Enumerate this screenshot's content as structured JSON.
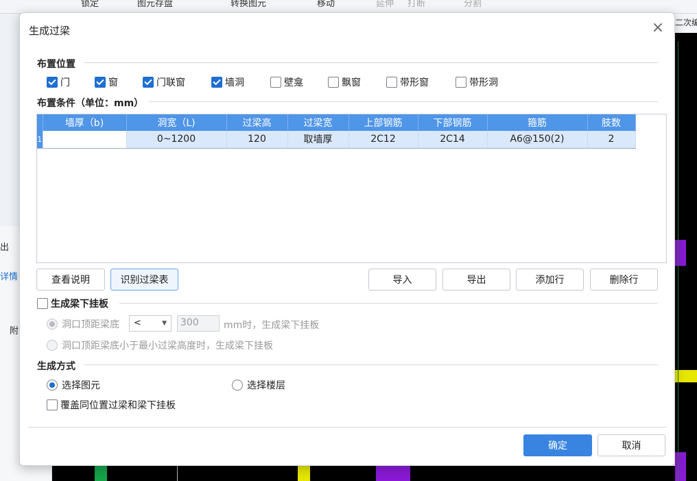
{
  "background": {
    "toolbar": [
      "锁定",
      "图元存盘",
      "转换图元",
      "移动",
      "延伸",
      "打断",
      "分割"
    ],
    "right_top_text": "二次编",
    "side_labels": [
      "出",
      "详情",
      "附"
    ]
  },
  "dialog": {
    "title": "生成过梁",
    "placement": {
      "title": "布置位置",
      "options": [
        {
          "label": "门",
          "checked": true
        },
        {
          "label": "窗",
          "checked": true
        },
        {
          "label": "门联窗",
          "checked": true
        },
        {
          "label": "墙洞",
          "checked": true
        },
        {
          "label": "壁龛",
          "checked": false
        },
        {
          "label": "飘窗",
          "checked": false
        },
        {
          "label": "带形窗",
          "checked": false
        },
        {
          "label": "带形洞",
          "checked": false
        }
      ]
    },
    "conditions": {
      "title": "布置条件（单位：mm）",
      "columns": [
        "墙厚（b)",
        "洞宽（L)",
        "过梁高",
        "过梁宽",
        "上部钢筋",
        "下部钢筋",
        "箍筋",
        "肢数"
      ],
      "rows": [
        {
          "index": "1",
          "cells": [
            "",
            "0~1200",
            "120",
            "取墙厚",
            "2C12",
            "2C14",
            "A6@150(2)",
            "2"
          ]
        }
      ]
    },
    "buttons": {
      "view_help": "查看说明",
      "recognize": "识别过梁表",
      "import": "导入",
      "export": "导出",
      "add_row": "添加行",
      "delete_row": "删除行"
    },
    "hanging": {
      "label": "生成梁下挂板",
      "checked": false,
      "option1_prefix": "洞口顶距梁底",
      "option1_operator": "<",
      "option1_value": "300",
      "option1_suffix": "mm时，生成梁下挂板",
      "option2": "洞口顶距梁底小于最小过梁高度时，生成梁下挂板"
    },
    "method": {
      "title": "生成方式",
      "select_element": "选择图元",
      "select_floor": "选择楼层",
      "selected": "选择图元",
      "overwrite": "覆盖同位置过梁和梁下挂板"
    },
    "ok": "确定",
    "cancel": "取消"
  }
}
